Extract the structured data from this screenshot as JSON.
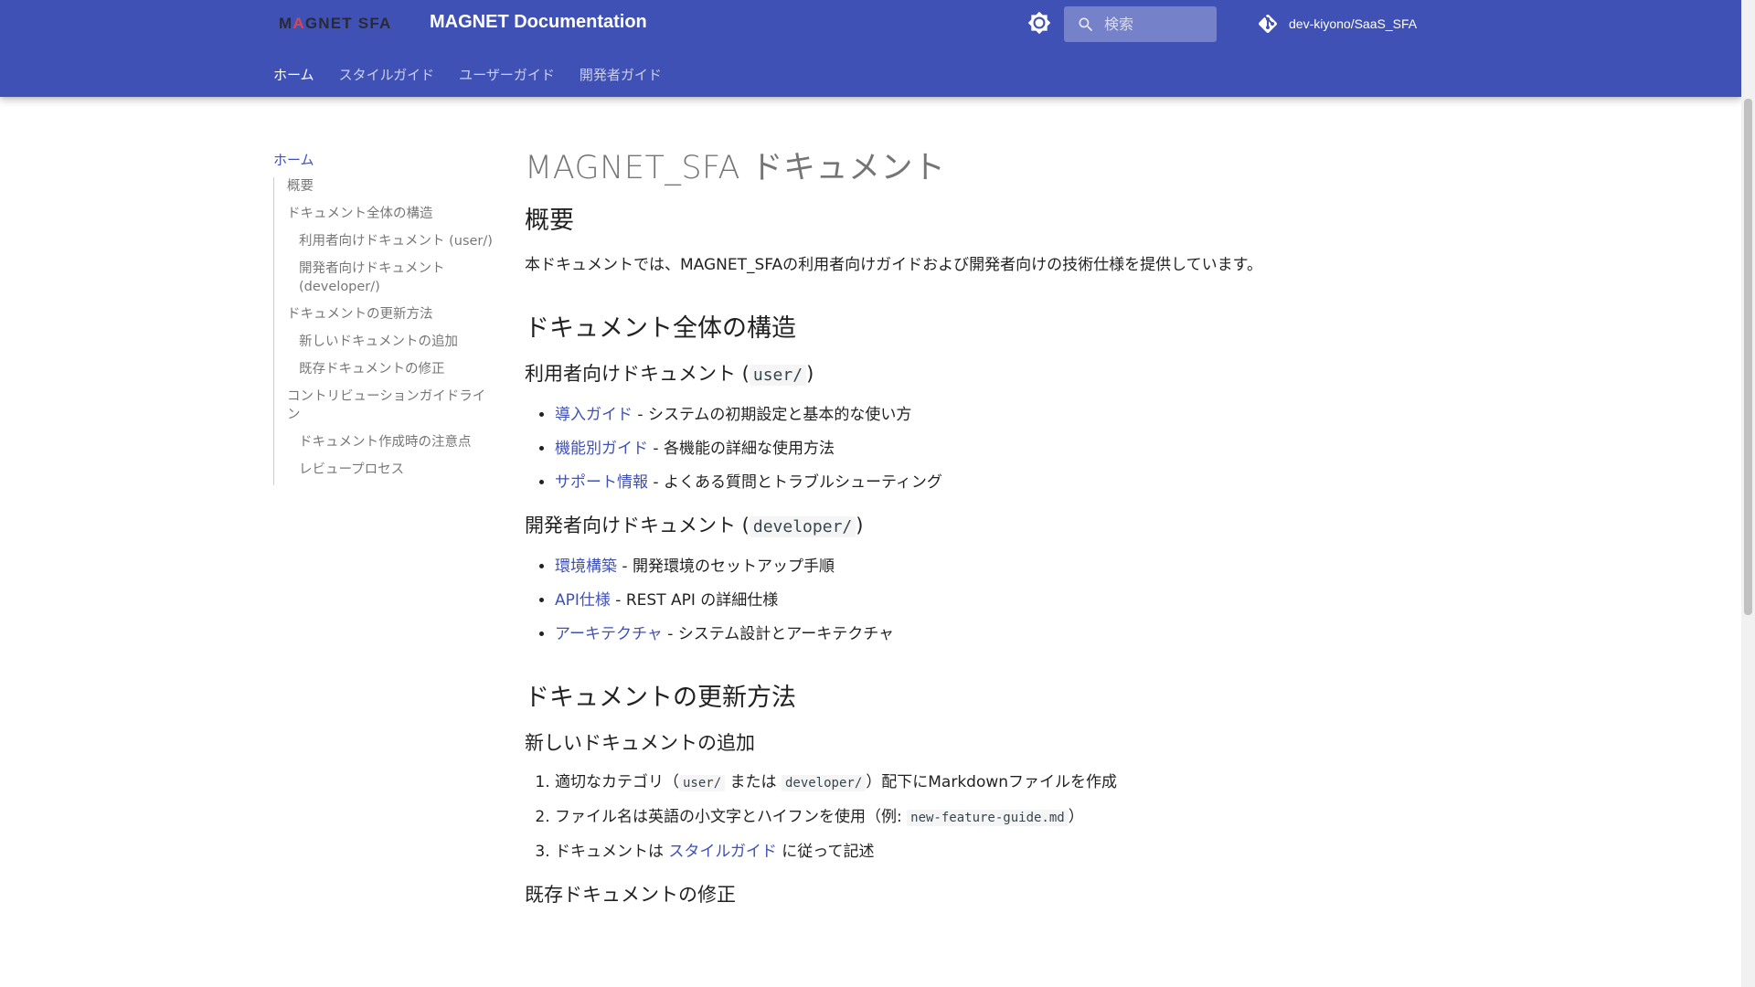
{
  "header": {
    "logo_text_before": "M",
    "logo_text_o": "A",
    "logo_text_after": "GNET SFA",
    "site_title": "MAGNET Documentation",
    "search_placeholder": "検索",
    "repo_name": "dev-kiyono/SaaS_SFA"
  },
  "tabs": [
    {
      "label": "ホーム",
      "active": true
    },
    {
      "label": "スタイルガイド",
      "active": false
    },
    {
      "label": "ユーザーガイド",
      "active": false
    },
    {
      "label": "開発者ガイド",
      "active": false
    }
  ],
  "toc": {
    "root": "ホーム",
    "items": [
      {
        "label": "概要",
        "level": 1
      },
      {
        "label": "ドキュメント全体の構造",
        "level": 1
      },
      {
        "label": "利用者向けドキュメント (user/)",
        "level": 2
      },
      {
        "label": "開発者向けドキュメント (developer/)",
        "level": 2
      },
      {
        "label": "ドキュメントの更新方法",
        "level": 1
      },
      {
        "label": "新しいドキュメントの追加",
        "level": 2
      },
      {
        "label": "既存ドキュメントの修正",
        "level": 2
      },
      {
        "label": "コントリビューションガイドライン",
        "level": 1
      },
      {
        "label": "ドキュメント作成時の注意点",
        "level": 2
      },
      {
        "label": "レビュープロセス",
        "level": 2
      }
    ]
  },
  "content": {
    "title": "MAGNET_SFA ドキュメント",
    "overview": {
      "heading": "概要",
      "text": "本ドキュメントでは、MAGNET_SFAの利用者向けガイドおよび開発者向けの技術仕様を提供しています。"
    },
    "structure": {
      "heading": "ドキュメント全体の構造",
      "user": {
        "heading_prefix": "利用者向けドキュメント (",
        "heading_code": "user/",
        "heading_suffix": ")",
        "items": [
          {
            "link": "導入ガイド",
            "text": " - システムの初期設定と基本的な使い方"
          },
          {
            "link": "機能別ガイド",
            "text": " - 各機能の詳細な使用方法"
          },
          {
            "link": "サポート情報",
            "text": " - よくある質問とトラブルシューティング"
          }
        ]
      },
      "developer": {
        "heading_prefix": "開発者向けドキュメント (",
        "heading_code": "developer/",
        "heading_suffix": ")",
        "items": [
          {
            "link": "環境構築",
            "text": " - 開発環境のセットアップ手順"
          },
          {
            "link": "API仕様",
            "text": " - REST API の詳細仕様"
          },
          {
            "link": "アーキテクチャ",
            "text": " - システム設計とアーキテクチャ"
          }
        ]
      }
    },
    "update": {
      "heading": "ドキュメントの更新方法",
      "new_doc": {
        "heading": "新しいドキュメントの追加",
        "step1": {
          "a": "適切なカテゴリ（",
          "code1": "user/",
          "b": " または ",
          "code2": "developer/",
          "c": "）配下にMarkdownファイルを作成"
        },
        "step2": {
          "a": "ファイル名は英語の小文字とハイフンを使用（例: ",
          "code": "new-feature-guide.md",
          "b": "）"
        },
        "step3": {
          "a": "ドキュメントは ",
          "link": "スタイルガイド",
          "b": " に従って記述"
        }
      },
      "edit_doc": {
        "heading": "既存ドキュメントの修正"
      }
    }
  },
  "colors": {
    "primary": "#4051b5",
    "link": "#4051b5",
    "logo_accent": "#e04545"
  },
  "icons": {
    "theme_toggle": "brightness-icon",
    "search": "search-icon",
    "repo": "git-icon"
  }
}
